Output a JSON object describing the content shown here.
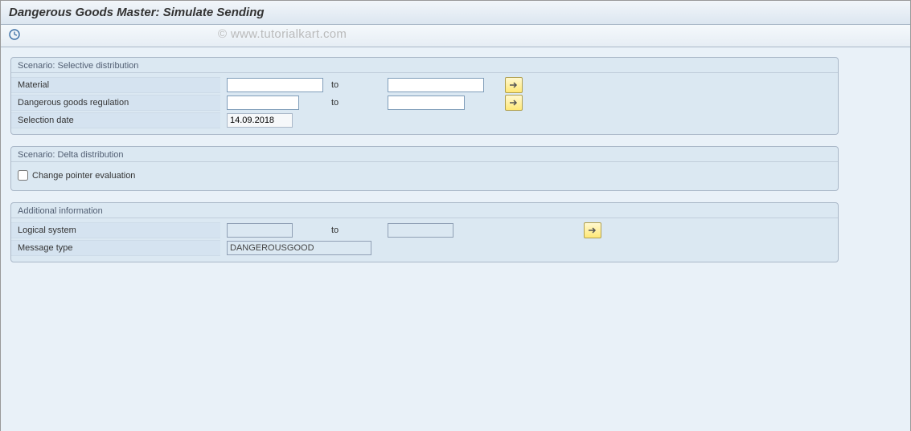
{
  "header": {
    "title": "Dangerous Goods Master: Simulate Sending"
  },
  "watermark": "© www.tutorialkart.com",
  "groups": {
    "selective": {
      "title": "Scenario: Selective distribution",
      "material": {
        "label": "Material",
        "from": "",
        "to_label": "to",
        "to": ""
      },
      "regulation": {
        "label": "Dangerous goods regulation",
        "from": "",
        "to_label": "to",
        "to": ""
      },
      "selection_date": {
        "label": "Selection date",
        "value": "14.09.2018"
      }
    },
    "delta": {
      "title": "Scenario: Delta distribution",
      "change_pointer": {
        "label": "Change pointer evaluation",
        "checked": false
      }
    },
    "additional": {
      "title": "Additional information",
      "logical_system": {
        "label": "Logical system",
        "from": "",
        "to_label": "to",
        "to": ""
      },
      "message_type": {
        "label": "Message type",
        "value": "DANGEROUSGOOD"
      }
    }
  }
}
